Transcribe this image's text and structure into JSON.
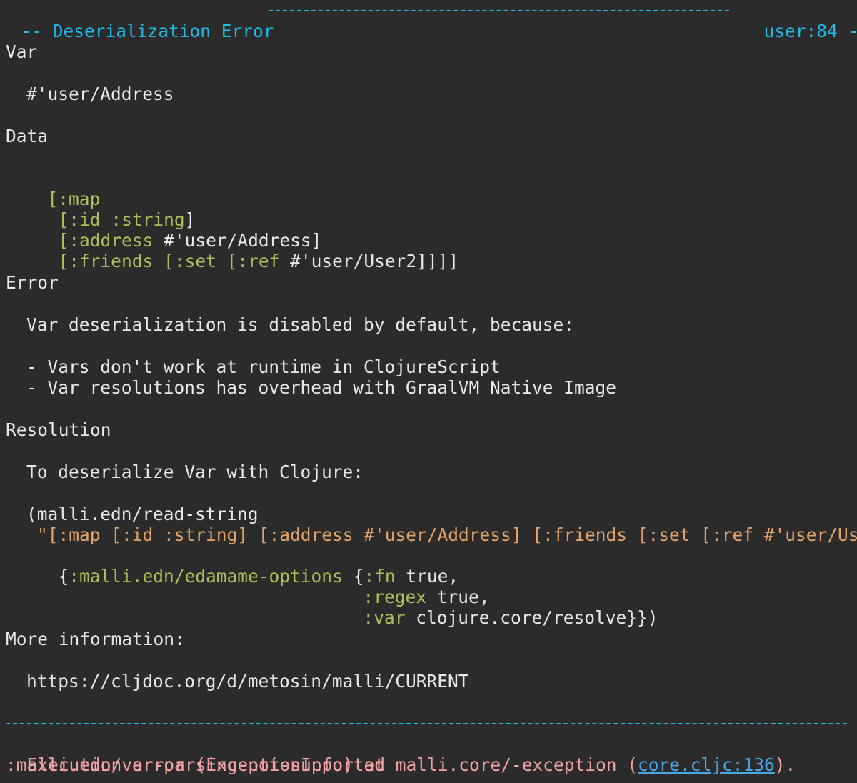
{
  "header": {
    "title": "Deserialization Error",
    "location": "user:84"
  },
  "sections": {
    "var": {
      "heading": "Var",
      "value": "#'user/Address"
    },
    "data": {
      "heading": "Data",
      "form": {
        "open": "[",
        "map": ":map",
        "id_key": ":id",
        "string_type": ":string",
        "address_key": ":address",
        "address_ref": "#'user/Address",
        "friends_key": ":friends",
        "set": ":set",
        "ref": ":ref",
        "user2_ref": "#'user/User2"
      }
    },
    "error": {
      "heading": "Error",
      "message": "Var deserialization is disabled by default, because:",
      "reasons": [
        "- Vars don't work at runtime in ClojureScript",
        "- Var resolutions has overhead with GraalVM Native Image"
      ]
    },
    "resolution": {
      "heading": "Resolution",
      "message": "To deserialize Var with Clojure:",
      "code": {
        "call": "(malli.edn/read-string",
        "string_arg": "\"[:map [:id :string] [:address #'user/Address] [:friends [:set [:ref #'user/Us",
        "options_key": ":malli.edn/edamame-options",
        "fn_key": ":fn",
        "regex_key": ":regex",
        "var_key": ":var",
        "true_value": "true",
        "resolve_fn": "clojure.core/resolve"
      }
    },
    "more_info": {
      "heading": "More information:",
      "url": "https://cljdoc.org/d/metosin/malli/CURRENT"
    }
  },
  "footer": {
    "error_prefix": "Execution error (ExceptionInfo) at malli.core/-exception (",
    "source_link": "core.cljc:136",
    "error_suffix": ").",
    "error_key": ":malli.edn/var-parsing-not-supported"
  },
  "colors": {
    "background": "#2b2b2b",
    "text": "#e8e8e8",
    "accent_cyan": "#1eb9e6",
    "keyword_green": "#a8c05a",
    "string_orange": "#e0a36c",
    "error_red": "#f0a3a0",
    "link_blue": "#4aa8e8"
  }
}
